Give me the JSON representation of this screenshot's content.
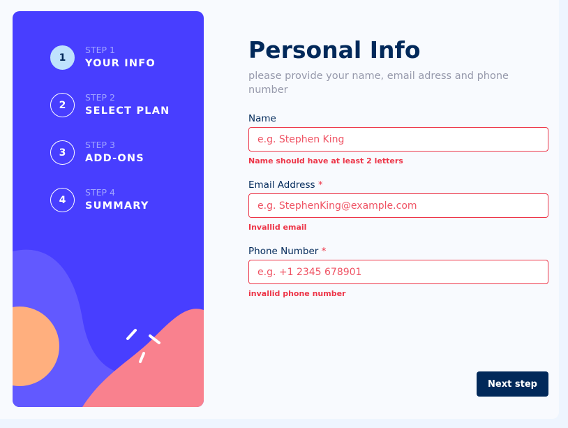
{
  "sidebar": {
    "steps": [
      {
        "number": "1",
        "caption": "STEP 1",
        "title": "YOUR INFO",
        "active": true
      },
      {
        "number": "2",
        "caption": "STEP 2",
        "title": "SELECT PLAN",
        "active": false
      },
      {
        "number": "3",
        "caption": "STEP 3",
        "title": "ADD-ONS",
        "active": false
      },
      {
        "number": "4",
        "caption": "STEP 4",
        "title": "SUMMARY",
        "active": false
      }
    ]
  },
  "main": {
    "title": "Personal Info",
    "subtitle": "please provide your name, email adress and phone number",
    "fields": {
      "name": {
        "label": "Name",
        "placeholder": "e.g. Stephen King",
        "value": "",
        "error": "Name should have at least 2 letters"
      },
      "email": {
        "label": "Email Address",
        "required_mark": "*",
        "placeholder": "e.g. StephenKing@example.com",
        "value": "",
        "error": "Invallid email"
      },
      "phone": {
        "label": "Phone Number",
        "required_mark": "*",
        "placeholder": "e.g. +1 2345 678901",
        "value": "",
        "error": "invallid phone number"
      }
    },
    "next_button": "Next step"
  },
  "colors": {
    "sidebar_bg": "#483eff",
    "primary_dark": "#02295a",
    "error": "#ed3548",
    "active_step": "#bfe2fd",
    "muted_text": "#9699ab"
  }
}
